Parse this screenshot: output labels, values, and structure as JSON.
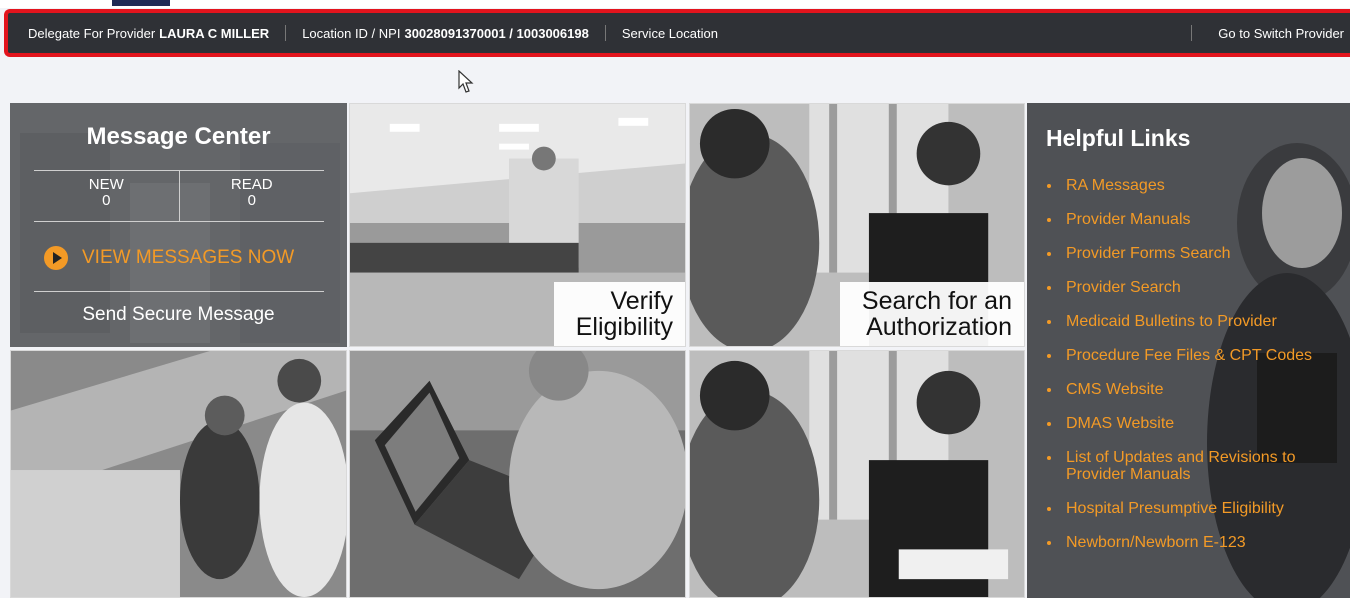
{
  "provider_bar": {
    "delegate_prefix": "Delegate For Provider",
    "delegate_name": "LAURA C MILLER",
    "location_prefix": "Location ID / NPI",
    "location_value": "30028091370001 / 1003006198",
    "service_location": "Service Location",
    "switch_provider": "Go to Switch Provider"
  },
  "message_center": {
    "title": "Message Center",
    "new_label": "NEW",
    "new_count": "0",
    "read_label": "READ",
    "read_count": "0",
    "view_now": "VIEW MESSAGES NOW",
    "send_secure": "Send Secure Message"
  },
  "tiles": {
    "verify": [
      "Verify",
      "Eligibility"
    ],
    "authorization": [
      "Search for an",
      "Authorization"
    ]
  },
  "helpful_links": {
    "title": "Helpful Links",
    "items": [
      "RA Messages",
      "Provider Manuals",
      "Provider Forms Search",
      "Provider Search",
      "Medicaid Bulletins to Provider",
      "Procedure Fee Files & CPT Codes",
      "CMS Website",
      "DMAS Website",
      "List of Updates and Revisions to Provider Manuals",
      "Hospital Presumptive Eligibility",
      "Newborn/Newborn E-123"
    ]
  },
  "colors": {
    "accent_orange": "#f39a26",
    "alert_red": "#e3141d",
    "bar_dark": "#2f3136"
  }
}
